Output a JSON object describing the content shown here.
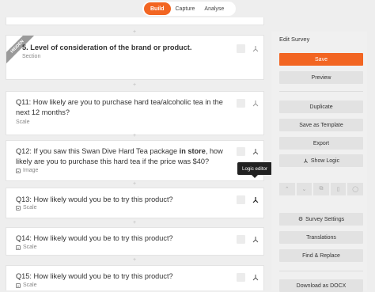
{
  "tabs": [
    {
      "label": "Build",
      "active": true
    },
    {
      "label": "Capture",
      "active": false
    },
    {
      "label": "Analyse",
      "active": false
    }
  ],
  "colors": {
    "accent": "#f26522",
    "panel": "#f0f0f0",
    "card": "#ffffff"
  },
  "questions": [
    {
      "id": "section-5",
      "text_prefix": "5. Level of consideration of the brand or product.",
      "type": "Section",
      "ribbon": "HIDDEN"
    },
    {
      "id": "q11",
      "text": "Q11: How likely are you to purchase hard tea/alcoholic tea in the next 12 months?",
      "type": "Scale"
    },
    {
      "id": "q12",
      "text_a": "Q12: If you saw this Swan Dive Hard Tea package ",
      "text_b": "in store",
      "text_c": ", how likely are you to purchase this hard tea if the price was $40?",
      "type": "Image"
    },
    {
      "id": "q13",
      "text": "Q13: How likely would you be to try this product?",
      "type": "Scale"
    },
    {
      "id": "q14",
      "text": "Q14: How likely would you be to try this product?",
      "type": "Scale"
    },
    {
      "id": "q15",
      "text": "Q15: How likely would you be to try this product?",
      "type": "Scale"
    }
  ],
  "tooltip": "Logic editor",
  "panel": {
    "title": "Edit Survey",
    "save": "Save",
    "preview": "Preview",
    "duplicate": "Duplicate",
    "save_template": "Save as Template",
    "export": "Export",
    "show_logic": "Show Logic",
    "survey_settings": "Survey Settings",
    "translations": "Translations",
    "find_replace": "Find & Replace",
    "download": "Download as DOCX"
  }
}
